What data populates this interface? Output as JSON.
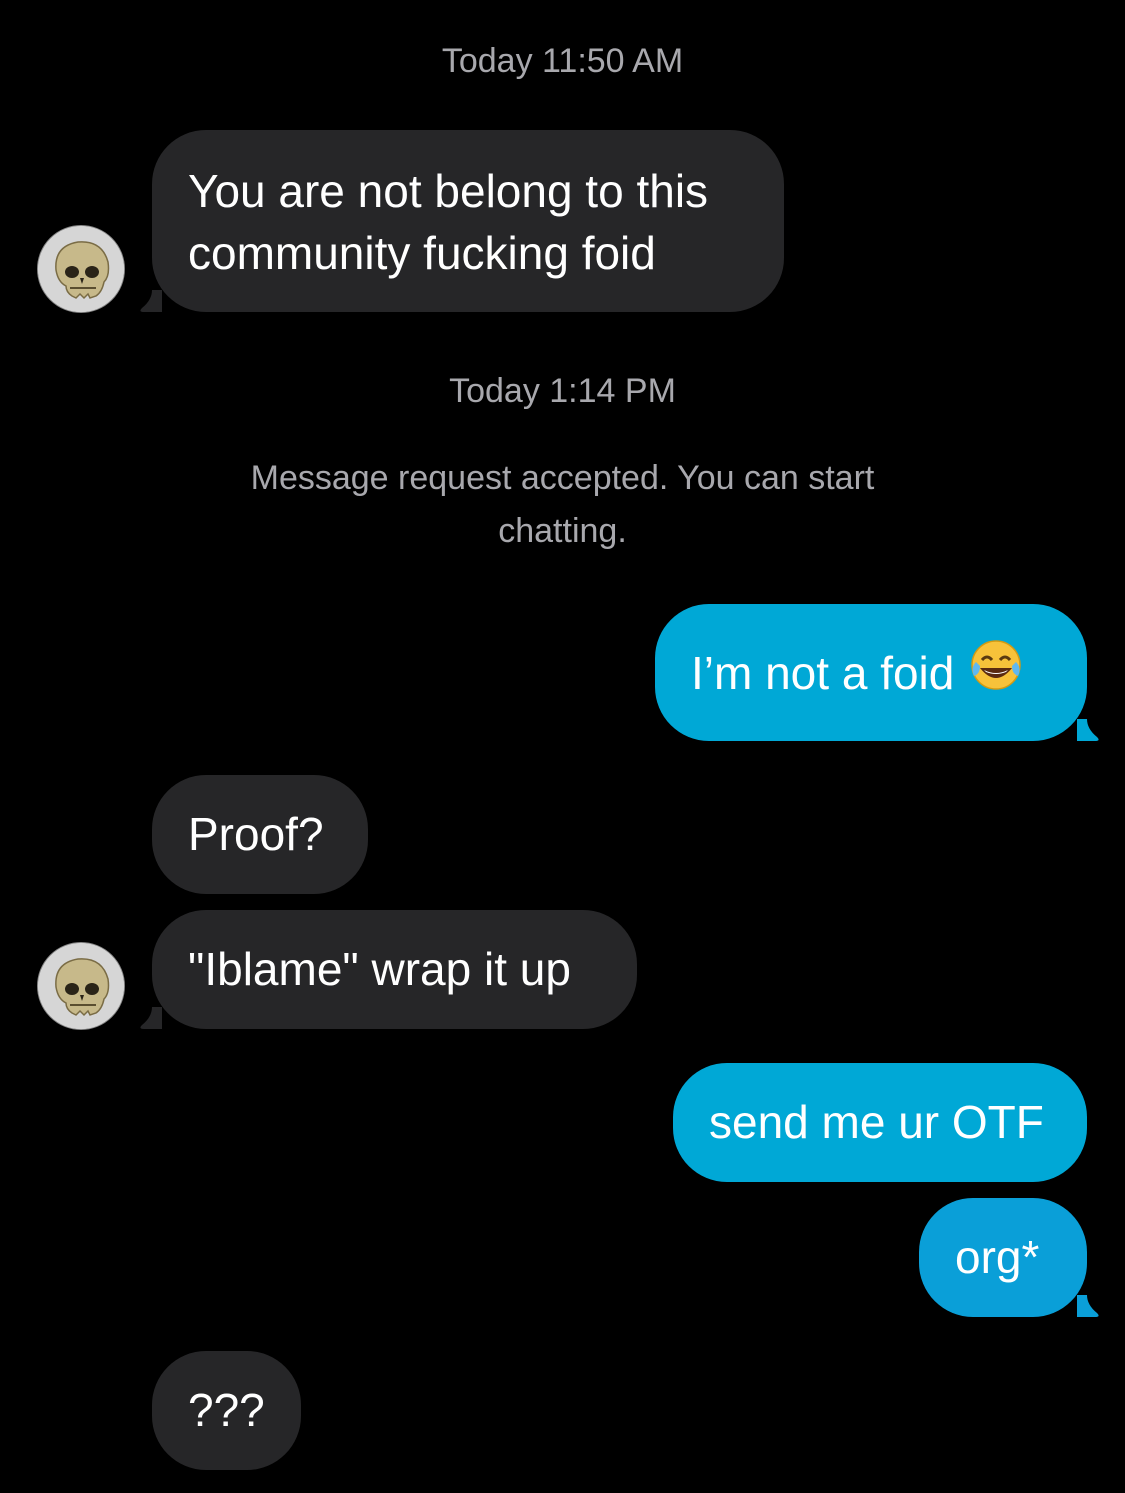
{
  "conversation": {
    "timestamp_1": "Today 11:50 AM",
    "msg_1": [
      "You are not belong to this",
      "community fucking foid"
    ],
    "timestamp_2": "Today 1:14 PM",
    "system_notice_line1": "Message request accepted. You can start",
    "system_notice_line2": "chatting.",
    "msg_2": "I’m not a foid",
    "msg_2_emoji": "face-with-tears-of-joy-icon",
    "msg_3": "Proof?",
    "msg_4": "\"Iblame\" wrap it up",
    "msg_5": "send me ur OTF",
    "msg_6": "org*",
    "msg_7": "???"
  },
  "colors": {
    "background": "#000000",
    "incoming_bubble": "#262628",
    "outgoing_bubble": "#00a8d6",
    "meta_text": "#a8a8ad"
  }
}
